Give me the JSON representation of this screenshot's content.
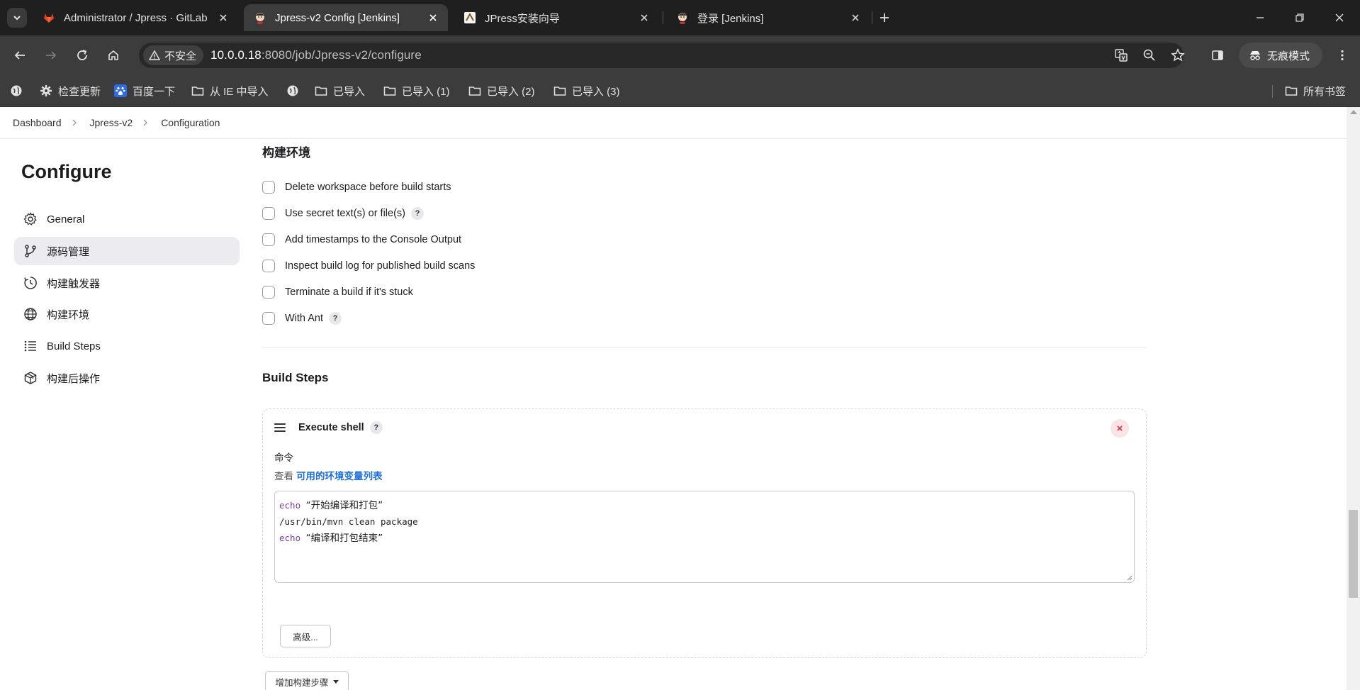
{
  "browser": {
    "tabs": [
      {
        "title": "Administrator / Jpress · GitLab",
        "active": false
      },
      {
        "title": "Jpress-v2 Config [Jenkins]",
        "active": true
      },
      {
        "title": "JPress安装向导",
        "active": false
      },
      {
        "title": "登录 [Jenkins]",
        "active": false
      }
    ],
    "security_label": "不安全",
    "url_host": "10.0.0.18",
    "url_path": ":8080/job/Jpress-v2/configure",
    "profile_label": "无痕模式",
    "bookmarks": [
      {
        "label": "",
        "icon": "globe-icon"
      },
      {
        "label": "检查更新",
        "icon": "gear-icon"
      },
      {
        "label": "百度一下",
        "icon": "baidu-paw-icon"
      },
      {
        "label": "从 IE 中导入",
        "icon": "folder-icon"
      },
      {
        "label": "",
        "icon": "globe-icon"
      },
      {
        "label": "已导入",
        "icon": "folder-icon"
      },
      {
        "label": "已导入 (1)",
        "icon": "folder-icon"
      },
      {
        "label": "已导入 (2)",
        "icon": "folder-icon"
      },
      {
        "label": "已导入 (3)",
        "icon": "folder-icon"
      }
    ],
    "all_bookmarks_label": "所有书签"
  },
  "breadcrumbs": [
    "Dashboard",
    "Jpress-v2",
    "Configuration"
  ],
  "sidebar": {
    "title": "Configure",
    "items": [
      {
        "label": "General",
        "icon": "gear-icon",
        "active": false
      },
      {
        "label": "源码管理",
        "icon": "branch-icon",
        "active": true
      },
      {
        "label": "构建触发器",
        "icon": "clock-icon",
        "active": false
      },
      {
        "label": "构建环境",
        "icon": "globe-icon",
        "active": false
      },
      {
        "label": "Build Steps",
        "icon": "list-icon",
        "active": false
      },
      {
        "label": "构建后操作",
        "icon": "package-icon",
        "active": false
      }
    ]
  },
  "build_env": {
    "title": "构建环境",
    "options": [
      {
        "label": "Delete workspace before build starts",
        "checked": false,
        "help": false
      },
      {
        "label": "Use secret text(s) or file(s)",
        "checked": false,
        "help": true
      },
      {
        "label": "Add timestamps to the Console Output",
        "checked": false,
        "help": false
      },
      {
        "label": "Inspect build log for published build scans",
        "checked": false,
        "help": false
      },
      {
        "label": "Terminate a build if it's stuck",
        "checked": false,
        "help": false
      },
      {
        "label": "With Ant",
        "checked": false,
        "help": true
      }
    ]
  },
  "build_steps": {
    "title": "Build Steps",
    "step": {
      "title": "Execute shell",
      "help": "?",
      "command_label": "命令",
      "env_prefix": "查看",
      "env_link": "可用的环境变量列表",
      "code_lines": [
        {
          "kw": "echo",
          "rest": "“开始编译和打包”"
        },
        {
          "kw": "",
          "rest": "/usr/bin/mvn clean package"
        },
        {
          "kw": "echo",
          "rest": "“编译和打包结束”"
        }
      ],
      "advanced_label": "高级..."
    },
    "add_step_label": "增加构建步骤"
  },
  "help_glyph": "?",
  "colors": {
    "accent": "#1d6fe0",
    "active_nav": "#ececf0",
    "delete": "#e0334a"
  }
}
